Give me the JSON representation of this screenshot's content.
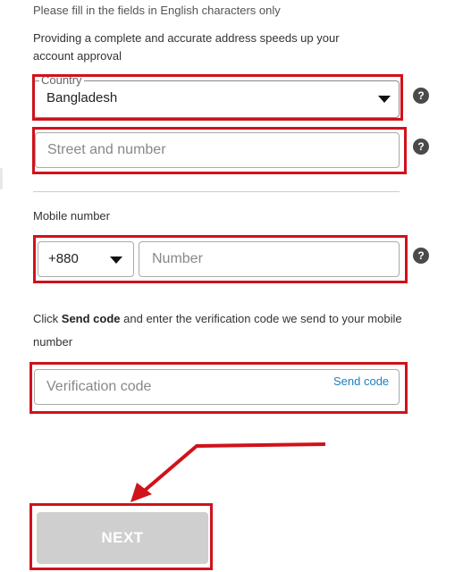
{
  "form": {
    "english_hint": "Please fill in the fields in English characters only",
    "intro_text": "Providing a complete and accurate address speeds up your account approval",
    "country_label": "Country",
    "country_value": "Bangladesh",
    "street_placeholder": "Street and number",
    "mobile_label": "Mobile number",
    "dial_code": "+880",
    "number_placeholder": "Number",
    "send_info_prefix": "Click ",
    "send_info_bold": "Send code",
    "send_info_suffix": " and enter the verification code we send to your mobile number",
    "verification_placeholder": "Verification code",
    "send_code_label": "Send code",
    "next_label": "NEXT",
    "help_glyph": "?"
  },
  "colors": {
    "highlight": "#d0121b",
    "link": "#1a7fc1",
    "disabled_button": "#cfcfcf"
  },
  "icons": {
    "help": "question-circle-icon",
    "caret": "caret-down-icon",
    "annotation": "red-arrow-annotation"
  }
}
